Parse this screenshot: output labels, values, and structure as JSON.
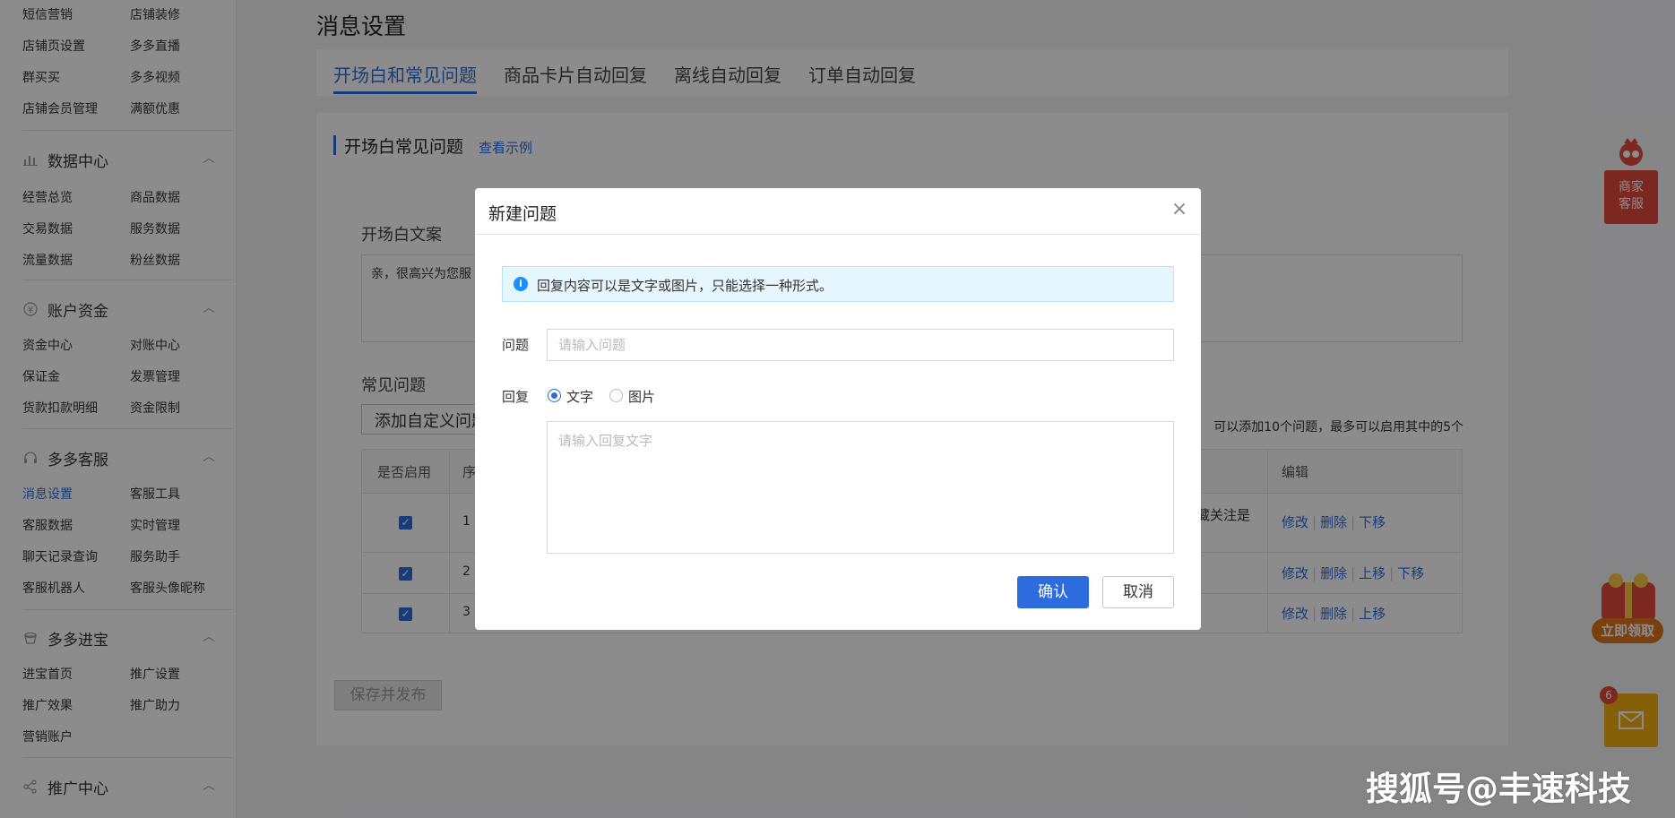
{
  "sidebar": {
    "top_pairs": [
      [
        "短信营销",
        "店铺装修"
      ],
      [
        "店铺页设置",
        "多多直播"
      ],
      [
        "群买买",
        "多多视频"
      ],
      [
        "店铺会员管理",
        "满额优惠"
      ]
    ],
    "sections": [
      {
        "title": "数据中心",
        "icon": "bar-chart-icon",
        "pairs": [
          [
            "经营总览",
            "商品数据"
          ],
          [
            "交易数据",
            "服务数据"
          ],
          [
            "流量数据",
            "粉丝数据"
          ]
        ]
      },
      {
        "title": "账户资金",
        "icon": "yen-icon",
        "pairs": [
          [
            "资金中心",
            "对账中心"
          ],
          [
            "保证金",
            "发票管理"
          ],
          [
            "货款扣款明细",
            "资金限制"
          ]
        ]
      },
      {
        "title": "多多客服",
        "icon": "headset-icon",
        "pairs": [
          [
            "消息设置",
            "客服工具"
          ],
          [
            "客服数据",
            "实时管理"
          ],
          [
            "聊天记录查询",
            "服务助手"
          ],
          [
            "客服机器人",
            "客服头像昵称"
          ]
        ]
      },
      {
        "title": "多多进宝",
        "icon": "treasure-icon",
        "pairs": [
          [
            "进宝首页",
            "推广设置"
          ],
          [
            "推广效果",
            "推广助力"
          ],
          [
            "营销账户",
            ""
          ]
        ]
      },
      {
        "title": "推广中心",
        "icon": "share-icon",
        "pairs": []
      }
    ],
    "active_item": "消息设置"
  },
  "page": {
    "title": "消息设置",
    "tabs": [
      "开场白和常见问题",
      "商品卡片自动回复",
      "离线自动回复",
      "订单自动回复"
    ],
    "section_title": "开场白常见问题",
    "section_link": "查看示例",
    "opening_label": "开场白文案",
    "opening_text": "亲，很高兴为您服",
    "faq_label": "常见问题",
    "add_button": "添加自定义问题",
    "faq_hint": "可以添加10个问题，最多可以启用其中的5个",
    "table": {
      "headers": [
        "是否启用",
        "序",
        "编辑"
      ],
      "rows": [
        {
          "num": "1",
          "extra": "藏关注是",
          "actions": [
            "修改",
            "删除",
            "下移"
          ]
        },
        {
          "num": "2",
          "extra": "",
          "actions": [
            "修改",
            "删除",
            "上移",
            "下移"
          ]
        },
        {
          "num": "3",
          "extra": "",
          "actions": [
            "修改",
            "删除",
            "上移"
          ]
        }
      ]
    },
    "save_button": "保存并发布"
  },
  "floating": {
    "service": "商家客服",
    "gift": "立即领取",
    "mail_badge": "6"
  },
  "modal": {
    "title": "新建问题",
    "info": "回复内容可以是文字或图片，只能选择一种形式。",
    "question_label": "问题",
    "question_placeholder": "请输入问题",
    "reply_label": "回复",
    "reply_options": [
      "文字",
      "图片"
    ],
    "reply_selected": "文字",
    "reply_placeholder": "请输入回复文字",
    "ok": "确认",
    "cancel": "取消"
  },
  "watermark": "搜狐号@丰速科技",
  "colors": {
    "accent": "#2d6cdf",
    "danger": "#e24a3b",
    "info_bg": "#e6f6fe"
  }
}
